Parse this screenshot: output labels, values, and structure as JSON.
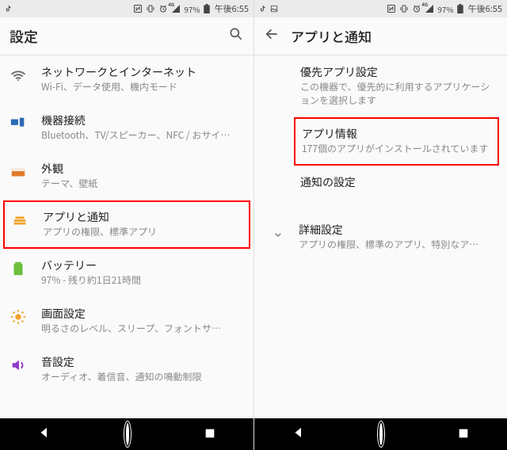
{
  "statusbar": {
    "battery_pct": "97%",
    "net_badge": "4G",
    "clock": "午後6:55"
  },
  "left": {
    "title": "設定",
    "items": [
      {
        "title": "ネットワークとインターネット",
        "sub": "Wi-Fi、データ使用、機内モード"
      },
      {
        "title": "機器接続",
        "sub": "Bluetooth、TV/スピーカー、NFC / おサイ…"
      },
      {
        "title": "外観",
        "sub": "テーマ、壁紙"
      },
      {
        "title": "アプリと通知",
        "sub": "アプリの権限、標準アプリ"
      },
      {
        "title": "バッテリー",
        "sub": "97% - 残り約1日21時間"
      },
      {
        "title": "画面設定",
        "sub": "明るさのレベル、スリープ、フォントサ…"
      },
      {
        "title": "音設定",
        "sub": "オーディオ、着信音、通知の鳴動制限"
      }
    ]
  },
  "right": {
    "title": "アプリと通知",
    "items": [
      {
        "title": "優先アプリ設定",
        "sub": "この機器で、優先的に利用するアプリケーションを選択します"
      },
      {
        "title": "アプリ情報",
        "sub": "177個のアプリがインストールされています"
      },
      {
        "title": "通知の設定",
        "sub": ""
      },
      {
        "title": "詳細設定",
        "sub": "アプリの権限、標準のアプリ、特別なア…"
      }
    ]
  },
  "colors": {
    "wifi": "#6b6b6b",
    "devices": "#2b6bb5",
    "appearance": "#e07a2c",
    "apps": "#f0a22a",
    "battery": "#6bbf3a",
    "display": "#f0a22a",
    "sound": "#8e3bc7"
  }
}
